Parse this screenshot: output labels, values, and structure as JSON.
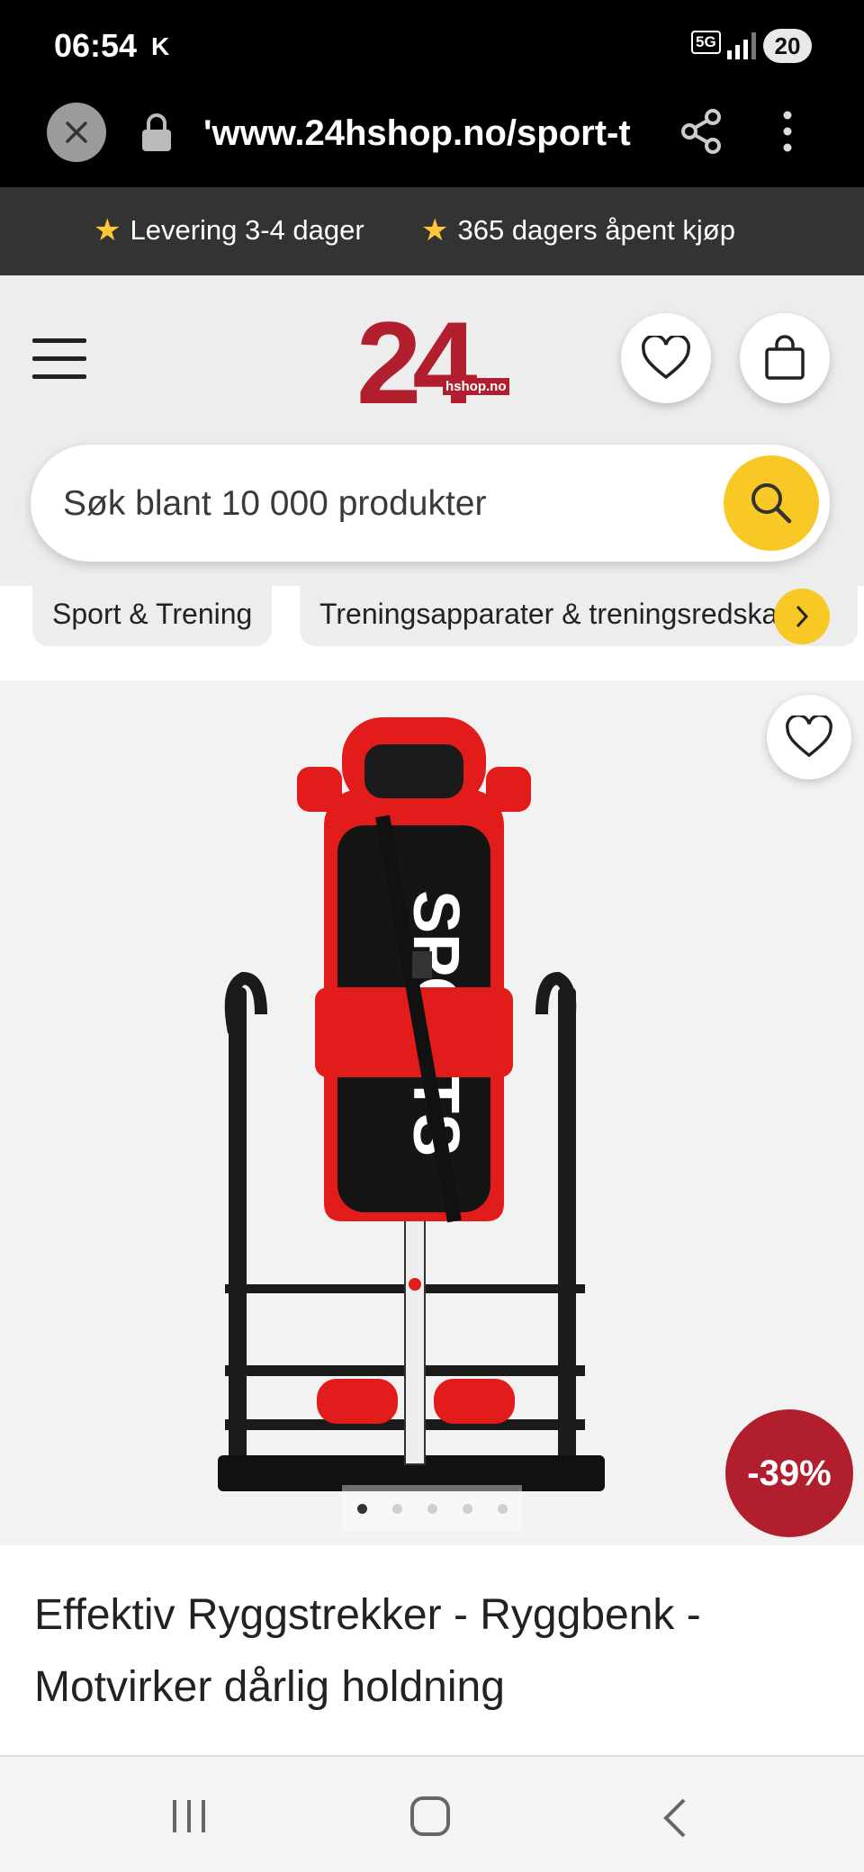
{
  "status_bar": {
    "time": "06:54",
    "carrier_mark": "K",
    "network": "5G",
    "battery": "20"
  },
  "browser": {
    "url": "'www.24hshop.no/sport-t"
  },
  "promo": [
    {
      "icon": "star",
      "text": "Levering 3-4 dager"
    },
    {
      "icon": "star",
      "text": "365 dagers åpent kjøp"
    }
  ],
  "header": {
    "logo_number": "24",
    "logo_sub": "hshop.no",
    "search_placeholder": "Søk blant 10 000 produkter"
  },
  "breadcrumb": [
    {
      "label": "Sport & Trening"
    },
    {
      "label": "Treningsapparater & treningsredskaper"
    }
  ],
  "product": {
    "image_text": "SPORTS",
    "discount": "-39%",
    "image_count": 5,
    "active_image": 1,
    "title": "Effektiv Ryggstrekker - Ryggbenk - Motvirker dårlig holdning"
  },
  "colors": {
    "brand": "#b11f2e",
    "accent": "#f7c826",
    "promo_bg": "#333333"
  }
}
